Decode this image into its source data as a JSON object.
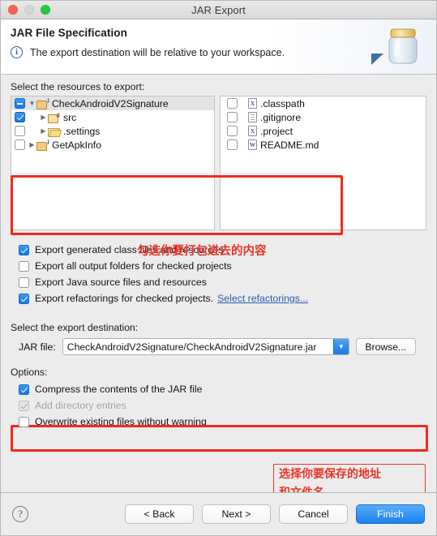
{
  "window": {
    "title": "JAR Export",
    "traffic_lights": [
      "close-red",
      "minimize-grey",
      "zoom-green"
    ]
  },
  "header": {
    "title": "JAR File Specification",
    "description": "The export destination will be relative to your workspace.",
    "info_icon": "info-icon",
    "art_icon": "jar-jar-icon"
  },
  "resources": {
    "label": "Select the resources to export:",
    "tree": [
      {
        "label": "CheckAndroidV2Signature",
        "state": "partial",
        "expanded": true,
        "depth": 0,
        "icon": "java-project-icon",
        "selected": true
      },
      {
        "label": "src",
        "state": "checked",
        "expanded": false,
        "depth": 1,
        "icon": "source-package-icon",
        "selected": false
      },
      {
        "label": ".settings",
        "state": "unchecked",
        "expanded": false,
        "depth": 1,
        "icon": "folder-icon",
        "selected": false
      },
      {
        "label": "GetApkInfo",
        "state": "unchecked",
        "expanded": false,
        "depth": 0,
        "icon": "java-project-icon",
        "selected": false
      }
    ],
    "files": [
      {
        "label": ".classpath",
        "state": "unchecked",
        "icon": "xml-file-icon",
        "badge": "X"
      },
      {
        "label": ".gitignore",
        "state": "unchecked",
        "icon": "text-file-icon",
        "badge": ""
      },
      {
        "label": ".project",
        "state": "unchecked",
        "icon": "xml-file-icon",
        "badge": "X"
      },
      {
        "label": "README.md",
        "state": "unchecked",
        "icon": "markdown-file-icon",
        "badge": "W"
      }
    ],
    "annotation": "勾选你要打包进去的内容"
  },
  "options_top": [
    {
      "label": "Export generated class files and resources",
      "state": "checked",
      "disabled": false
    },
    {
      "label": "Export all output folders for checked projects",
      "state": "unchecked",
      "disabled": false
    },
    {
      "label": "Export Java source files and resources",
      "state": "unchecked",
      "disabled": false
    },
    {
      "label": "Export refactorings for checked projects.",
      "state": "checked",
      "disabled": false,
      "link": "Select refactorings..."
    }
  ],
  "destination": {
    "label": "Select the export destination:",
    "field_label": "JAR file:",
    "value": "CheckAndroidV2Signature/CheckAndroidV2Signature.jar",
    "placeholder": "",
    "dropdown_icon": "chevron-down-icon",
    "browse_label": "Browse...",
    "annotation_line1": "选择你要保存的地址",
    "annotation_line2": "和文件名"
  },
  "options": {
    "label": "Options:",
    "items": [
      {
        "label": "Compress the contents of the JAR file",
        "state": "checked",
        "disabled": false
      },
      {
        "label": "Add directory entries",
        "state": "checked",
        "disabled": true
      },
      {
        "label": "Overwrite existing files without warning",
        "state": "unchecked",
        "disabled": false
      }
    ]
  },
  "footer": {
    "help_icon": "help-icon",
    "buttons": [
      {
        "label": "< Back",
        "primary": false
      },
      {
        "label": "Next >",
        "primary": false
      },
      {
        "label": "Cancel",
        "primary": false
      },
      {
        "label": "Finish",
        "primary": true
      }
    ]
  },
  "colors": {
    "accent_blue": "#1a82ef",
    "annotation_red": "#e8352a",
    "link_blue": "#2a5db0"
  }
}
